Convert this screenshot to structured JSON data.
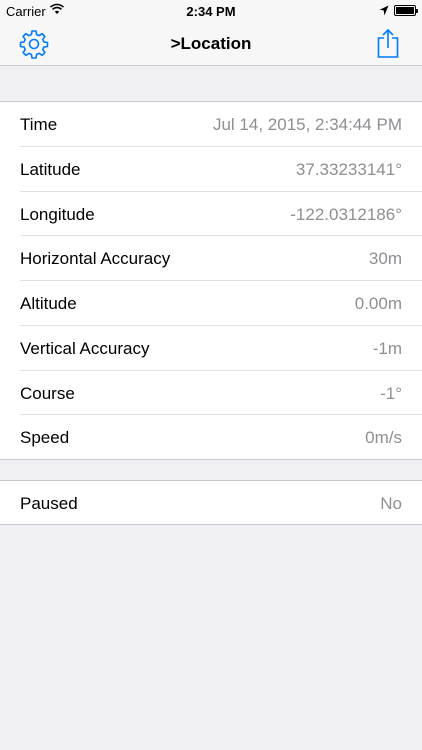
{
  "status_bar": {
    "carrier": "Carrier",
    "time": "2:34 PM",
    "wifi_icon": "wifi-icon",
    "location_icon": "location-arrow-icon",
    "battery_icon": "battery-icon"
  },
  "nav": {
    "title": ">Location",
    "left_icon": "gear-icon",
    "right_icon": "share-icon"
  },
  "location_rows": [
    {
      "label": "Time",
      "value": "Jul 14, 2015, 2:34:44 PM"
    },
    {
      "label": "Latitude",
      "value": "37.33233141°"
    },
    {
      "label": "Longitude",
      "value": "-122.0312186°"
    },
    {
      "label": "Horizontal Accuracy",
      "value": "30m"
    },
    {
      "label": "Altitude",
      "value": "0.00m"
    },
    {
      "label": "Vertical Accuracy",
      "value": "-1m"
    },
    {
      "label": "Course",
      "value": "-1°"
    },
    {
      "label": "Speed",
      "value": "0m/s"
    }
  ],
  "status_rows": [
    {
      "label": "Paused",
      "value": "No"
    }
  ],
  "colors": {
    "accent": "#007aff",
    "background": "#efeff4",
    "secondary_text": "#8e8e93"
  }
}
